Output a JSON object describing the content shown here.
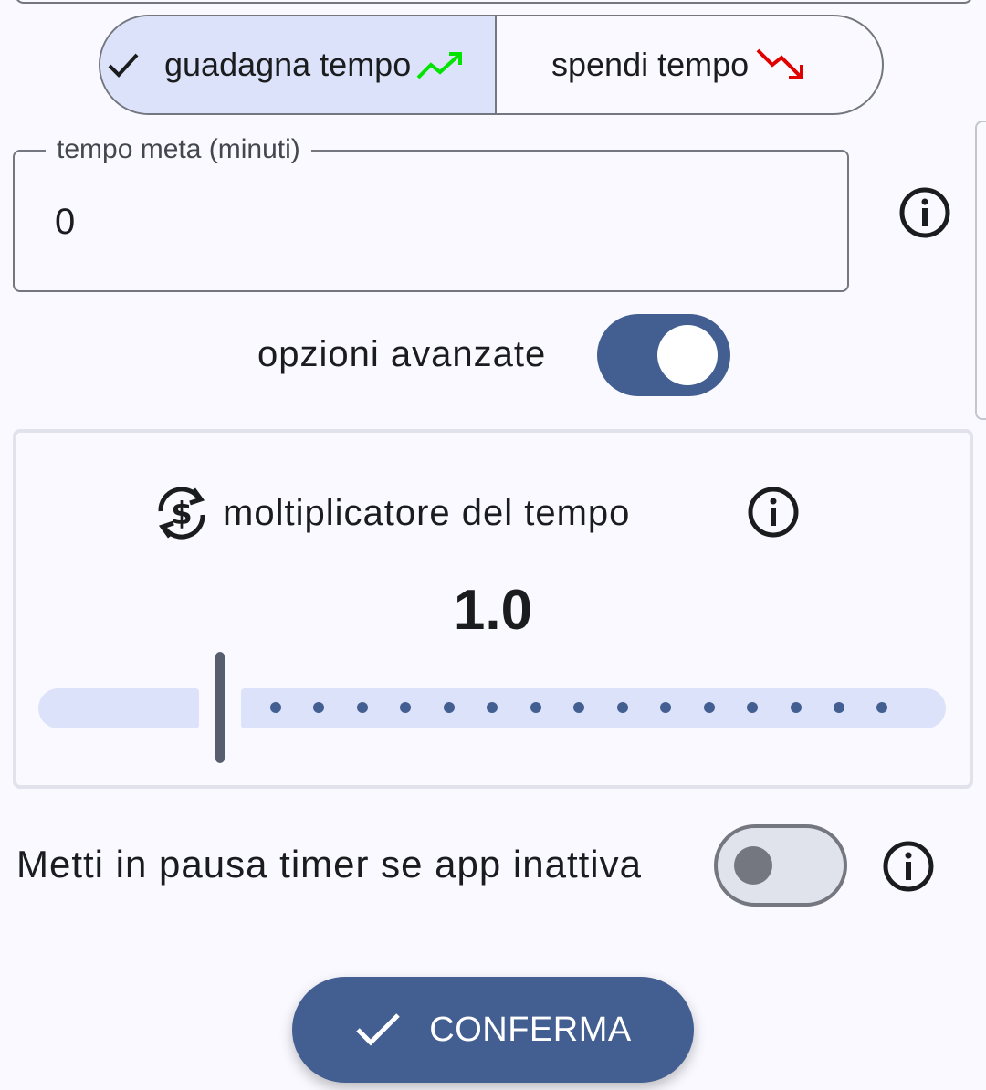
{
  "mode_toggle": {
    "options": [
      {
        "label": "guadagna tempo",
        "icon": "trending-up-icon",
        "selected": true
      },
      {
        "label": "spendi tempo",
        "icon": "trending-down-icon",
        "selected": false
      }
    ]
  },
  "goal_field": {
    "label": "tempo meta (minuti)",
    "value": "0"
  },
  "advanced_options": {
    "label": "opzioni avanzate",
    "enabled": true
  },
  "multiplier": {
    "title": "moltiplicatore del tempo",
    "value": "1.0",
    "icon": "currency-exchange-icon"
  },
  "pause_option": {
    "label": "Metti in pausa timer se app inattiva",
    "enabled": false
  },
  "confirm_button": {
    "label": "CONFERMA"
  },
  "colors": {
    "primary": "#435e91",
    "selected_segment": "#dce2f9",
    "trend_up": "#00e400",
    "trend_down": "#e00000",
    "background": "#f9f9ff"
  }
}
